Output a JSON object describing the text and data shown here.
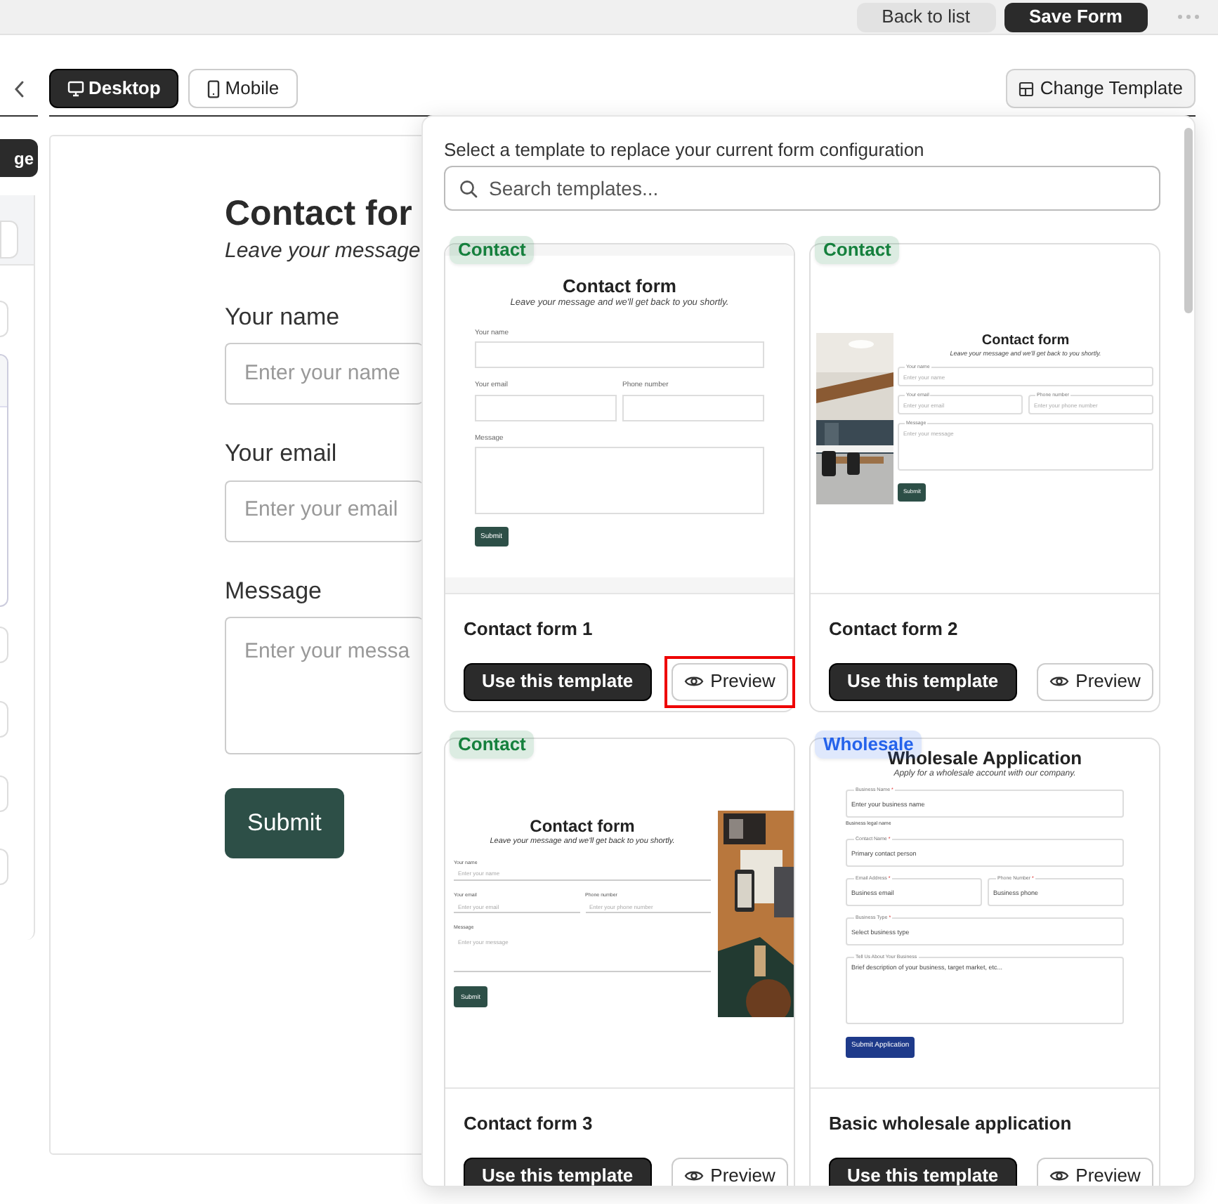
{
  "top_bar": {
    "buttons": [
      {
        "label": "Back to list",
        "kind": "secondary"
      },
      {
        "label": "Save Form",
        "kind": "primary"
      }
    ]
  },
  "view_tabs": [
    {
      "label": "Desktop",
      "selected": true
    },
    {
      "label": "Mobile",
      "selected": false
    }
  ],
  "change_template_button": "Change Template",
  "side_panel": {
    "button": "ge"
  },
  "form_preview": {
    "title": "Contact for",
    "subtitle": "Leave your message",
    "fields": [
      {
        "label": "Your name",
        "placeholder": "Enter your name",
        "kind": "input"
      },
      {
        "label": "Your email",
        "placeholder": "Enter your email",
        "kind": "input"
      },
      {
        "label": "Message",
        "placeholder": "Enter your messa",
        "kind": "textarea"
      }
    ],
    "submit": "Submit"
  },
  "template_picker": {
    "instruction": "Select a template to replace your current form configuration",
    "search": {
      "placeholder": "Search templates..."
    },
    "templates": [
      {
        "badge": "Contact",
        "color": "#15803d",
        "name": "Contact form 1",
        "use_button": "Use this template",
        "preview_button": "Preview",
        "preview_highlighted": true,
        "thumbnail": {
          "kind": "boxed",
          "title": "Contact form",
          "subtitle": "Leave your message and we'll get back to you shortly.",
          "rows": [
            [
              {
                "label": "Your name",
                "kind": "input"
              }
            ],
            [
              {
                "label": "Your email",
                "kind": "input"
              },
              {
                "label": "Phone number",
                "kind": "input"
              }
            ],
            [
              {
                "label": "Message",
                "kind": "textarea"
              }
            ]
          ],
          "submit": "Submit"
        }
      },
      {
        "badge": "Contact",
        "color": "#15803d",
        "name": "Contact form 2",
        "use_button": "Use this template",
        "preview_button": "Preview",
        "preview_highlighted": false,
        "thumbnail": {
          "kind": "image_left",
          "title": "Contact form",
          "subtitle": "Leave your message and we'll get back to you shortly.",
          "rows": [
            [
              {
                "label": "Your name",
                "placeholder": "Enter your name",
                "kind": "input"
              }
            ],
            [
              {
                "label": "Your email",
                "placeholder": "Enter your email",
                "kind": "input"
              },
              {
                "label": "Phone number",
                "placeholder": "Enter your phone number",
                "kind": "input"
              }
            ],
            [
              {
                "label": "Message",
                "placeholder": "Enter your message",
                "kind": "textarea"
              }
            ]
          ],
          "submit": "Submit"
        }
      },
      {
        "badge": "Contact",
        "color": "#15803d",
        "name": "Contact form 3",
        "use_button": "Use this template",
        "preview_button": "Preview",
        "preview_highlighted": false,
        "thumbnail": {
          "kind": "image_right",
          "title": "Contact form",
          "subtitle": "Leave your message and we'll get back to you shortly.",
          "rows": [
            [
              {
                "label": "Your name",
                "placeholder": "Enter your name",
                "kind": "input"
              }
            ],
            [
              {
                "label": "Your email",
                "placeholder": "Enter your email",
                "kind": "input"
              },
              {
                "label": "Phone number",
                "placeholder": "Enter your phone number",
                "kind": "input"
              }
            ],
            [
              {
                "label": "Message",
                "placeholder": "Enter your message",
                "kind": "textarea"
              }
            ]
          ],
          "submit": "Submit"
        }
      },
      {
        "badge": "Wholesale",
        "color": "#2563eb",
        "name": "Basic wholesale application",
        "use_button": "Use this template",
        "preview_button": "Preview",
        "preview_highlighted": false,
        "thumbnail": {
          "kind": "wholesale",
          "title": "Wholesale Application",
          "subtitle": "Apply for a wholesale account with our company.",
          "rows": [
            [
              {
                "label": "Business Name",
                "required_mark": "*",
                "placeholder": "Enter your business name",
                "helper": "Business legal name",
                "kind": "input"
              }
            ],
            [
              {
                "label": "Contact Name",
                "required_mark": "*",
                "placeholder": "Primary contact person",
                "kind": "input"
              }
            ],
            [
              {
                "label": "Email Address",
                "required_mark": "*",
                "placeholder": "Business email",
                "kind": "input"
              },
              {
                "label": "Phone Number",
                "required_mark": "*",
                "placeholder": "Business phone",
                "kind": "input"
              }
            ],
            [
              {
                "label": "Business Type",
                "required_mark": "*",
                "placeholder": "Select business type",
                "kind": "input"
              }
            ],
            [
              {
                "label": "Tell Us About Your Business",
                "placeholder": "Brief description of your business, target market, etc...",
                "kind": "textarea"
              }
            ]
          ],
          "submit": "Submit Application"
        }
      }
    ]
  }
}
